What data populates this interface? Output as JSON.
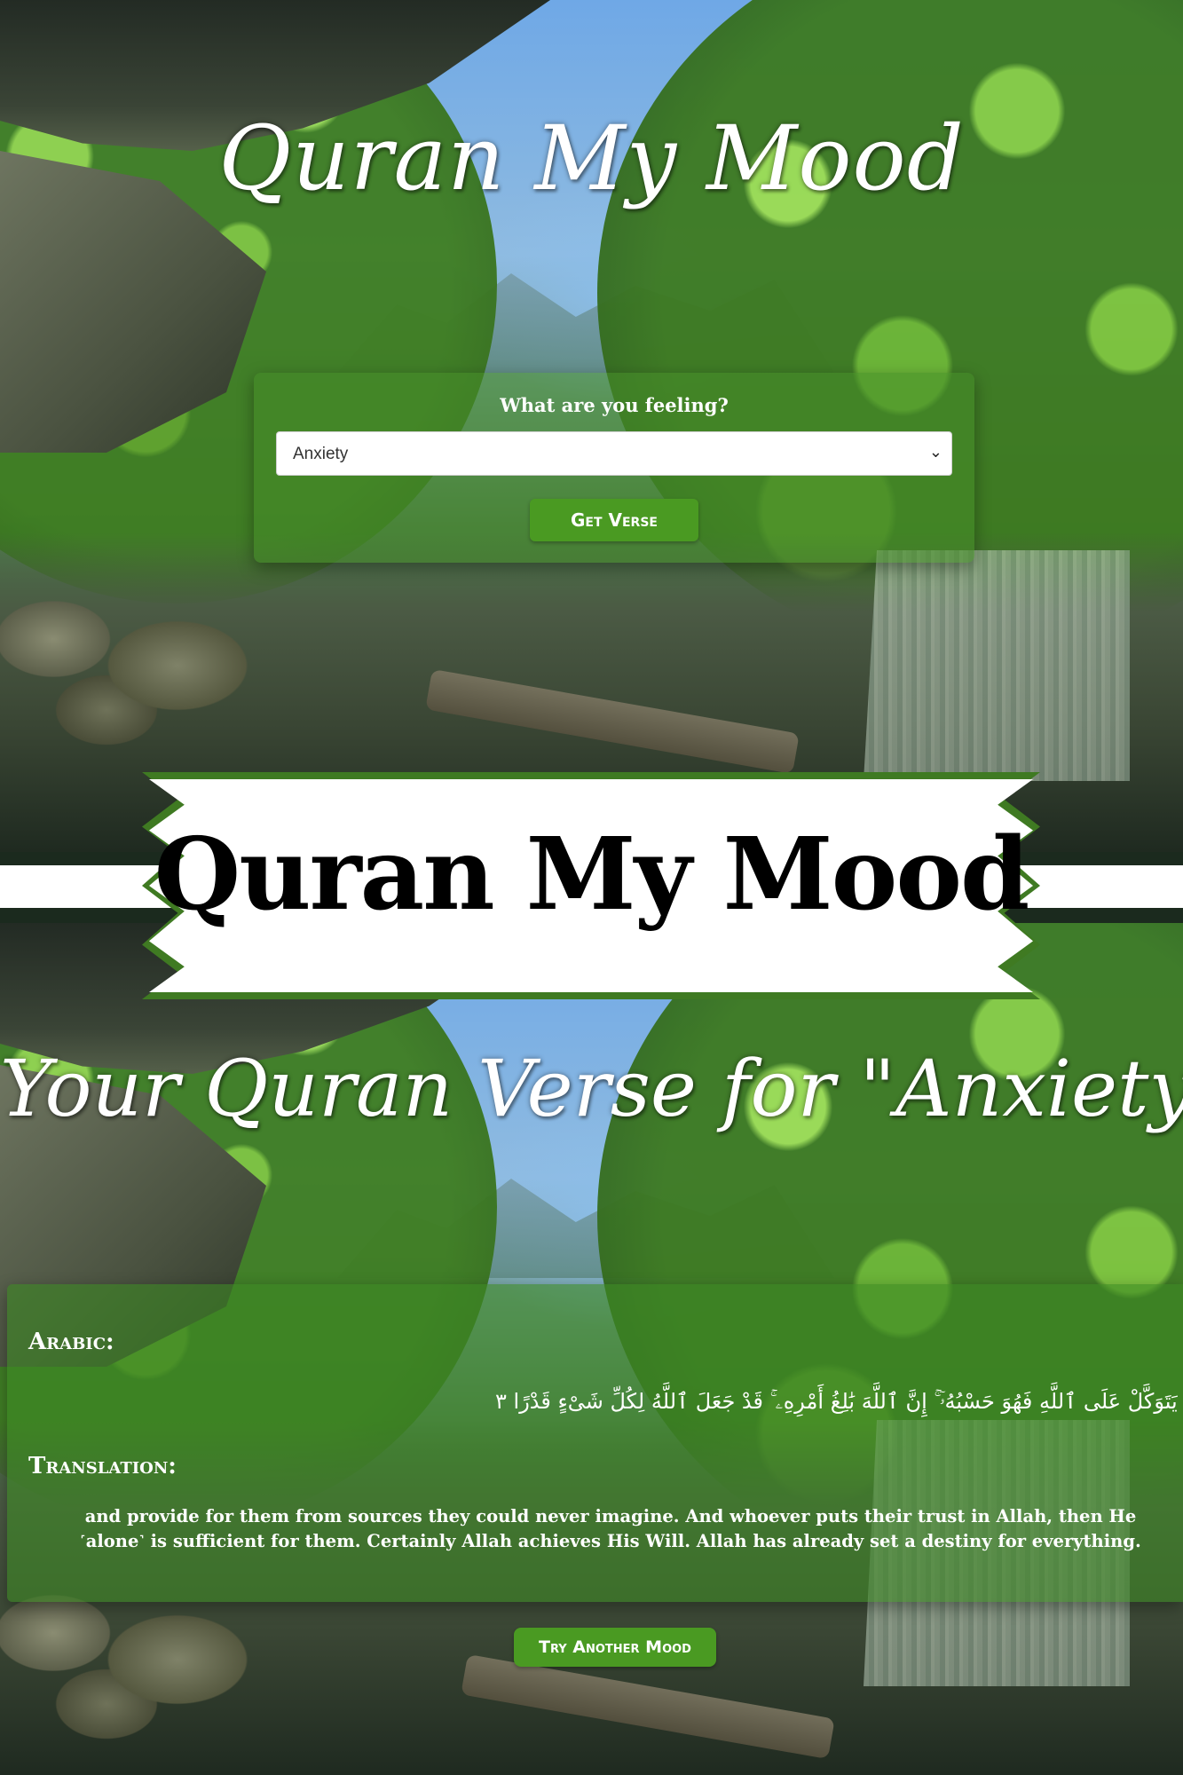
{
  "top": {
    "title": "Quran My Mood",
    "question": "What are you feeling?",
    "select": {
      "value": "Anxiety"
    },
    "button": "Get Verse"
  },
  "banner": {
    "title": "Quran My Mood"
  },
  "result": {
    "title": "Your Quran Verse for \"Anxiety\"",
    "arabic_label": "Arabic:",
    "arabic": "وَيَرْزُقْهُ مِنْ حَيْثُ لَا يَحْتَسِبُ ۚ وَمَن يَتَوَكَّلْ عَلَى ٱللَّهِ فَهُوَ حَسْبُهُۥٓ ۚ إِنَّ ٱللَّهَ بَٰلِغُ أَمْرِهِۦ ۚ قَدْ جَعَلَ ٱللَّهُ لِكُلِّ شَىْءٍ قَدْرًا ٣",
    "translation_label": "Translation:",
    "translation": "and provide for them from sources they could never imagine. And whoever puts their trust in Allah, then He ˹alone˺ is sufficient for them. Certainly Allah achieves His Will. Allah has already set a destiny for everything.",
    "button": "Try Another Mood"
  },
  "colors": {
    "accent_green": "#4a9a22",
    "banner_border": "#3f7a22"
  }
}
